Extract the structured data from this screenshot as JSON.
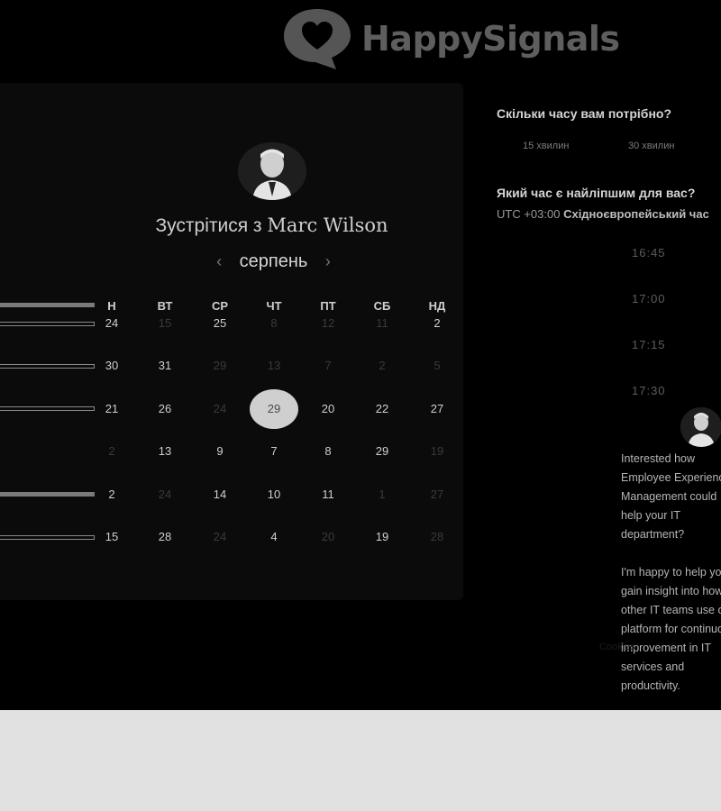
{
  "brand": {
    "name": "HappySignals",
    "logo_icon": "heart-speech-bubble-icon",
    "color": "#5e5e5e"
  },
  "booking": {
    "title_prefix": "Зустрітися з",
    "host_name": "Marc Wilson",
    "month": "серпень",
    "prev_icon": "chevron-left-icon",
    "next_icon": "chevron-right-icon",
    "weekdays": [
      "Н",
      "ВТ",
      "СР",
      "ЧТ",
      "ПТ",
      "СБ",
      "НД"
    ],
    "weeks": [
      [
        {
          "d": "24",
          "a": true
        },
        {
          "d": "15",
          "a": false
        },
        {
          "d": "25",
          "a": true
        },
        {
          "d": "8",
          "a": false
        },
        {
          "d": "12",
          "a": false
        },
        {
          "d": "11",
          "a": false
        },
        {
          "d": "2",
          "a": true
        }
      ],
      [
        {
          "d": "30",
          "a": true
        },
        {
          "d": "31",
          "a": true
        },
        {
          "d": "29",
          "a": false
        },
        {
          "d": "13",
          "a": false
        },
        {
          "d": "7",
          "a": false
        },
        {
          "d": "2",
          "a": false
        },
        {
          "d": "5",
          "a": false
        }
      ],
      [
        {
          "d": "21",
          "a": true
        },
        {
          "d": "26",
          "a": true
        },
        {
          "d": "24",
          "a": false
        },
        {
          "d": "29",
          "a": true,
          "s": true
        },
        {
          "d": "20",
          "a": true
        },
        {
          "d": "22",
          "a": true
        },
        {
          "d": "27",
          "a": true
        }
      ],
      [
        {
          "d": "2",
          "a": false
        },
        {
          "d": "13",
          "a": true
        },
        {
          "d": "9",
          "a": true
        },
        {
          "d": "7",
          "a": true
        },
        {
          "d": "8",
          "a": true
        },
        {
          "d": "29",
          "a": true
        },
        {
          "d": "19",
          "a": false
        }
      ],
      [
        {
          "d": "2",
          "a": true
        },
        {
          "d": "24",
          "a": false
        },
        {
          "d": "14",
          "a": true
        },
        {
          "d": "10",
          "a": true
        },
        {
          "d": "11",
          "a": true
        },
        {
          "d": "1",
          "a": false
        },
        {
          "d": "27",
          "a": false
        }
      ],
      [
        {
          "d": "15",
          "a": true
        },
        {
          "d": "28",
          "a": true
        },
        {
          "d": "24",
          "a": false
        },
        {
          "d": "4",
          "a": true
        },
        {
          "d": "20",
          "a": false
        },
        {
          "d": "19",
          "a": true
        },
        {
          "d": "28",
          "a": false
        }
      ]
    ]
  },
  "panel": {
    "duration_question": "Скільки часу вам потрібно?",
    "durations": [
      "15 хвилин",
      "30 хвилин"
    ],
    "time_question": "Який час є найліпшим для вас?",
    "timezone_offset": "UTC +03:00",
    "timezone_name": "Східноєвропейський час",
    "times": [
      "16:45",
      "17:00",
      "17:15",
      "17:30"
    ]
  },
  "host_card": {
    "paragraphs": [
      "Interested how Employee Experience Management could help your IT department?",
      "I'm happy to help you gain insight into how other IT teams use our platform for continuous improvement in IT services and productivity."
    ]
  },
  "footer": {
    "link": "Cookies"
  }
}
